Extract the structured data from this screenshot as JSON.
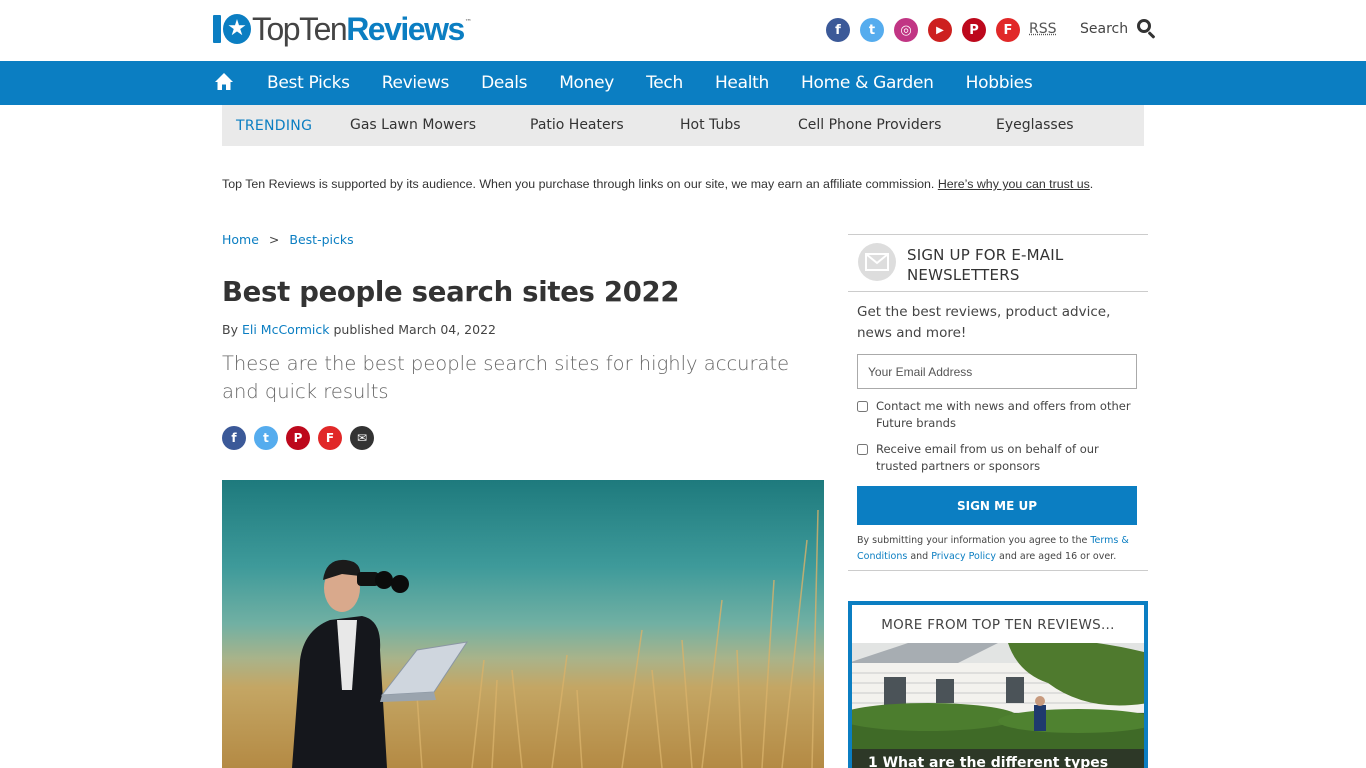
{
  "header": {
    "logo": {
      "text_a": "Top",
      "text_b": "Ten",
      "text_c": "Reviews",
      "tm": "™"
    },
    "socials": [
      {
        "name": "facebook",
        "glyph": "f",
        "color": "#3b5998"
      },
      {
        "name": "twitter",
        "glyph": "t",
        "color": "#55acee"
      },
      {
        "name": "instagram",
        "glyph": "◎",
        "color": "#c13584"
      },
      {
        "name": "youtube",
        "glyph": "▶",
        "color": "#cd201f"
      },
      {
        "name": "pinterest",
        "glyph": "P",
        "color": "#bd081c"
      },
      {
        "name": "flipboard",
        "glyph": "F",
        "color": "#e12828"
      }
    ],
    "rss_label": "RSS",
    "search_label": "Search"
  },
  "nav": {
    "items": [
      "Best Picks",
      "Reviews",
      "Deals",
      "Money",
      "Tech",
      "Health",
      "Home & Garden",
      "Hobbies"
    ]
  },
  "trending": {
    "label": "TRENDING",
    "items": [
      "Gas Lawn Mowers",
      "Patio Heaters",
      "Hot Tubs",
      "Cell Phone Providers",
      "Eyeglasses"
    ]
  },
  "affiliate": {
    "text": "Top Ten Reviews is supported by its audience. When you purchase through links on our site, we may earn an affiliate commission.",
    "link": "Here’s why you can trust us",
    "end": "."
  },
  "article": {
    "breadcrumb": {
      "home": "Home",
      "sep": ">",
      "current": "Best-picks"
    },
    "title": "Best people search sites 2022",
    "byline": {
      "by": "By",
      "author": "Eli McCormick",
      "published": "published March 04, 2022"
    },
    "strap": "These are the best people search sites for highly accurate and quick results",
    "share": [
      {
        "name": "facebook",
        "glyph": "f",
        "color": "#3b5998"
      },
      {
        "name": "twitter",
        "glyph": "t",
        "color": "#55acee"
      },
      {
        "name": "pinterest",
        "glyph": "P",
        "color": "#bd081c"
      },
      {
        "name": "flipboard",
        "glyph": "F",
        "color": "#e12828"
      },
      {
        "name": "email",
        "glyph": "✉",
        "color": "#333333"
      }
    ]
  },
  "newsletter": {
    "title": "SIGN UP FOR E-MAIL NEWSLETTERS",
    "description": "Get the best reviews, product advice, news and more!",
    "email_placeholder": "Your Email Address",
    "checkbox_1": "Contact me with news and offers from other Future brands",
    "checkbox_2": "Receive email from us on behalf of our trusted partners or sponsors",
    "button": "SIGN ME UP",
    "legal": {
      "pre": "By submitting your information you agree to the",
      "terms": "Terms & Conditions",
      "and": "and",
      "privacy": "Privacy Policy",
      "post": "and are aged 16 or over."
    }
  },
  "more": {
    "title": "MORE FROM TOP TEN REVIEWS...",
    "caption": "1 What are the different types"
  },
  "colors": {
    "brand": "#0b7ec2",
    "trending_bg": "#eaeaea"
  }
}
